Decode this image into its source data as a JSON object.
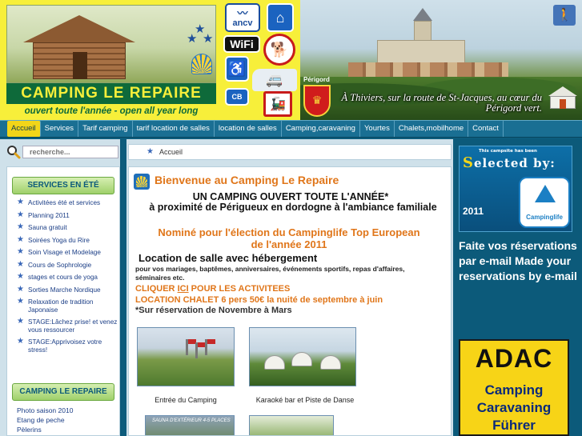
{
  "header": {
    "logo_title": "CAMPING  LE REPAIRE",
    "logo_subtitle": "ouvert toute l'année - open all year long",
    "badges": {
      "ancv": "ancv",
      "wifi": "WiFi",
      "cb": "CB"
    },
    "region": "Périgord",
    "tagline": "À Thiviers, sur la route de St-Jacques, au cœur du Périgord vert.",
    "icons": [
      "house-icon",
      "star-icon",
      "shell-icon",
      "family-house-icon",
      "wifi-icon",
      "dog-icon",
      "wheelchair-icon",
      "camper-van-icon",
      "credit-card-icon",
      "train-icon",
      "hiker-icon",
      "coat-of-arms-icon",
      "yurt-icon"
    ]
  },
  "nav": {
    "items": [
      {
        "label": "Accueil",
        "active": true
      },
      {
        "label": "Services"
      },
      {
        "label": "Tarif camping"
      },
      {
        "label": "tarif location de salles"
      },
      {
        "label": "location de salles"
      },
      {
        "label": "Camping,caravaning"
      },
      {
        "label": "Yourtes"
      },
      {
        "label": "Chalets,mobilhome"
      },
      {
        "label": "Contact"
      }
    ]
  },
  "sidebar": {
    "search_placeholder": "recherche...",
    "services_title": "SERVICES EN ÉTÉ",
    "services": [
      "Activitées été et services",
      "Planning 2011",
      "Sauna gratuit",
      "Soirées Yoga du Rire",
      "Soin Visage et Modelage",
      "Cours de Sophrologie",
      "stages et cours de yoga",
      "Sorties Marche Nordique",
      "Relaxation de tradition Japonaise",
      "STAGE:Lâchez prise! et venez vous ressourcer",
      "STAGE:Apprivoisez votre stress!"
    ],
    "repaire_title": "CAMPING LE REPAIRE",
    "repaire_links": [
      "Photo saison 2010",
      "Etang de peche",
      "Pèlerins"
    ]
  },
  "main": {
    "breadcrumb": "Accueil",
    "welcome_title": "Bienvenue au Camping Le Repaire",
    "headline1": "UN CAMPING OUVERT TOUTE L'ANNÉE*",
    "headline2": "à proximité de Périgueux en dordogne à l'ambiance familiale",
    "nominee": "Nominé pour l'élection du Campinglife Top European de l'année 2011",
    "salle_title": "Location de salle avec hébergement",
    "salle_text": "pour vos mariages, baptêmes, anniversaires, événements sportifs, repas d'affaires, séminaires etc.",
    "cliquer_prefix": "CLIQUER ",
    "cliquer_link": "ICI",
    "cliquer_suffix": " POUR LES ACTIVITEES",
    "chalet": "LOCATION CHALET 6 pers 50€ la nuité de septembre à juin",
    "reservation": "*Sur réservation de Novembre à Mars",
    "captions": {
      "entree": "Entrée du Camping",
      "karaoke": "Karaoké bar et Piste de Danse"
    },
    "sauna_label": "SAUNA D'EXTÉRIEUR 4-5 PLACES"
  },
  "right": {
    "clife_top": "This campsite has been",
    "clife_selected_initial": "S",
    "clife_selected_rest": "elected by:",
    "clife_year": "2011",
    "clife_name": "Campinglife",
    "reserve_text": "Faite vos réservations par e-mail Made your reservations by e-mail",
    "adac_logo": "ADAC",
    "adac_line1": "Camping",
    "adac_line2": "Caravaning",
    "adac_line3": "Führer"
  }
}
